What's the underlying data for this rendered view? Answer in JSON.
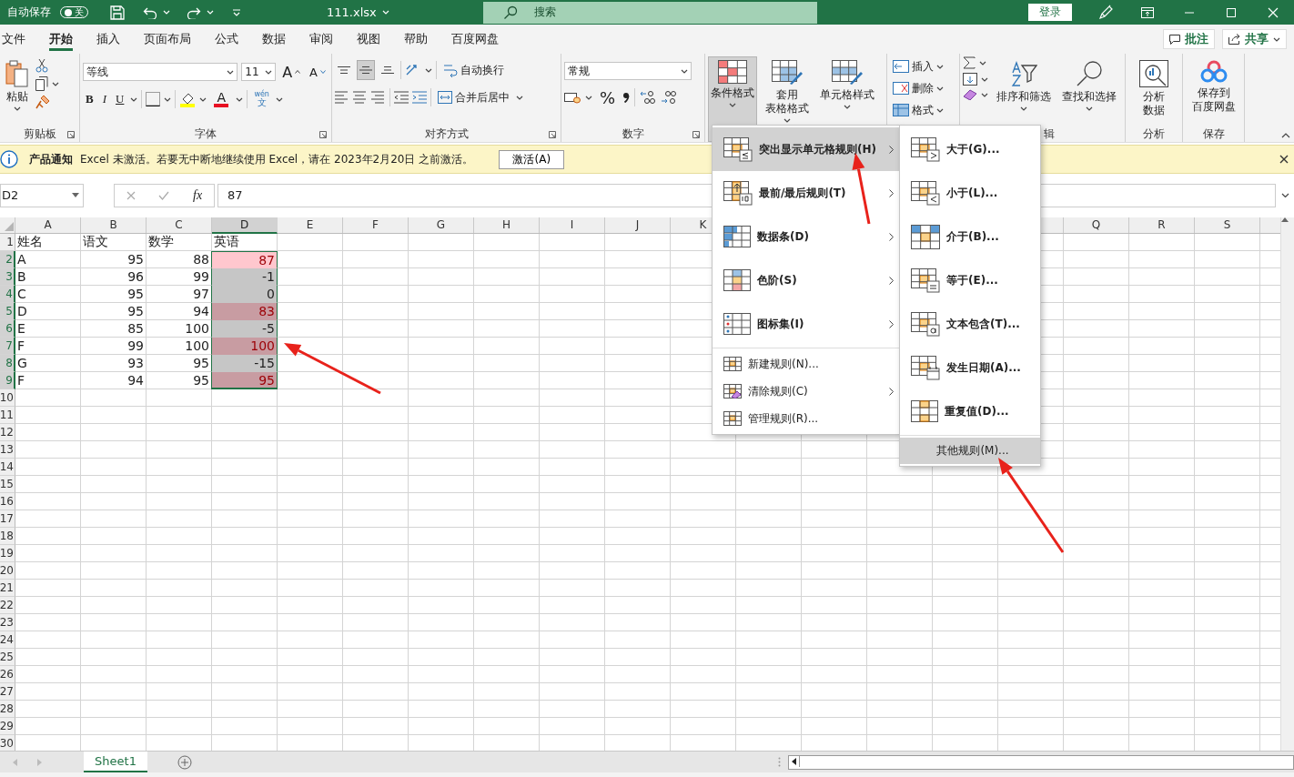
{
  "title_bar": {
    "autosave_label": "自动保存",
    "autosave": {
      "on": false,
      "label": "关"
    },
    "file_name": "111.xlsx",
    "search_placeholder": "搜索",
    "sign_in": "登录"
  },
  "tabs": [
    {
      "label": "文件",
      "selected": false
    },
    {
      "label": "开始",
      "selected": true
    },
    {
      "label": "插入",
      "selected": false
    },
    {
      "label": "页面布局",
      "selected": false
    },
    {
      "label": "公式",
      "selected": false
    },
    {
      "label": "数据",
      "selected": false
    },
    {
      "label": "审阅",
      "selected": false
    },
    {
      "label": "视图",
      "selected": false
    },
    {
      "label": "帮助",
      "selected": false
    },
    {
      "label": "百度网盘",
      "selected": false
    }
  ],
  "ribbon_actions": {
    "comments": "批注",
    "share": "共享"
  },
  "ribbon": {
    "clipboard": {
      "paste": "粘贴",
      "label": "剪贴板"
    },
    "font": {
      "font_name": "等线",
      "font_size": "11",
      "grow": "A",
      "shrink": "A",
      "bold": "B",
      "italic": "I",
      "underline": "U",
      "font_color": "A",
      "phonetic": [
        "wén",
        "文"
      ],
      "label": "字体"
    },
    "alignment": {
      "vertical_align": [
        {
          "selected": false
        },
        {
          "selected": true
        },
        {
          "selected": false
        }
      ],
      "wrap_text": "自动换行",
      "merge_center": "合并后居中",
      "label": "对齐方式"
    },
    "number": {
      "format": "常规",
      "percent": "%",
      "label": "数字"
    },
    "styles": [
      {
        "lines": [
          "条件格式"
        ],
        "pressed": true
      },
      {
        "lines": [
          "套用",
          "表格格式"
        ],
        "pressed": false
      },
      {
        "lines": [
          "单元格样式"
        ],
        "pressed": false
      }
    ],
    "cells": [
      {
        "label": "插入"
      },
      {
        "label": "删除"
      },
      {
        "label": "格式"
      }
    ],
    "editing": {
      "sort_filter": "排序和筛选",
      "find_select": "查找和选择",
      "label": "辑"
    },
    "analysis": {
      "button": [
        "分析",
        "数据"
      ],
      "label": "分析"
    },
    "save": {
      "button": [
        "保存到",
        "百度网盘"
      ],
      "label": "保存"
    }
  },
  "notification": {
    "title": "产品通知",
    "message": "Excel 未激活。若要无中断地继续使用 Excel，请在 2023年2月20日 之前激活。",
    "button": "激活(A)"
  },
  "formula_bar": {
    "name_box": "D2",
    "fx": "fx",
    "value": "87"
  },
  "columns": [
    {
      "label": "A",
      "selected": false
    },
    {
      "label": "B",
      "selected": false
    },
    {
      "label": "C",
      "selected": false
    },
    {
      "label": "D",
      "selected": true
    },
    {
      "label": "E",
      "selected": false
    },
    {
      "label": "F",
      "selected": false
    },
    {
      "label": "G",
      "selected": false
    },
    {
      "label": "H",
      "selected": false
    },
    {
      "label": "I",
      "selected": false
    },
    {
      "label": "J",
      "selected": false
    },
    {
      "label": "K",
      "selected": false
    },
    {
      "label": "Q",
      "selected": false
    },
    {
      "label": "R",
      "selected": false
    },
    {
      "label": "S",
      "selected": false
    }
  ],
  "rows": [
    {
      "number": "1",
      "selected": false,
      "cells": [
        {
          "value": "姓名",
          "kind": "text"
        },
        {
          "value": "语文",
          "kind": "text"
        },
        {
          "value": "数学",
          "kind": "text"
        },
        {
          "value": "英语",
          "kind": "text"
        }
      ]
    },
    {
      "number": "2",
      "selected": true,
      "cells": [
        {
          "value": "A",
          "kind": "text"
        },
        {
          "value": "95",
          "kind": "number"
        },
        {
          "value": "88",
          "kind": "number"
        },
        {
          "value": "87",
          "kind": "number",
          "highlight": true,
          "in_selection": true,
          "active": true
        }
      ]
    },
    {
      "number": "3",
      "selected": true,
      "cells": [
        {
          "value": "B",
          "kind": "text"
        },
        {
          "value": "96",
          "kind": "number"
        },
        {
          "value": "99",
          "kind": "number"
        },
        {
          "value": "-1",
          "kind": "number",
          "highlight": false,
          "in_selection": true,
          "active": false
        }
      ]
    },
    {
      "number": "4",
      "selected": true,
      "cells": [
        {
          "value": "C",
          "kind": "text"
        },
        {
          "value": "95",
          "kind": "number"
        },
        {
          "value": "97",
          "kind": "number"
        },
        {
          "value": "0",
          "kind": "number",
          "highlight": false,
          "in_selection": true,
          "active": false
        }
      ]
    },
    {
      "number": "5",
      "selected": true,
      "cells": [
        {
          "value": "D",
          "kind": "text"
        },
        {
          "value": "95",
          "kind": "number"
        },
        {
          "value": "94",
          "kind": "number"
        },
        {
          "value": "83",
          "kind": "number",
          "highlight": true,
          "in_selection": true,
          "active": false
        }
      ]
    },
    {
      "number": "6",
      "selected": true,
      "cells": [
        {
          "value": "E",
          "kind": "text"
        },
        {
          "value": "85",
          "kind": "number"
        },
        {
          "value": "100",
          "kind": "number"
        },
        {
          "value": "-5",
          "kind": "number",
          "highlight": false,
          "in_selection": true,
          "active": false
        }
      ]
    },
    {
      "number": "7",
      "selected": true,
      "cells": [
        {
          "value": "F",
          "kind": "text"
        },
        {
          "value": "99",
          "kind": "number"
        },
        {
          "value": "100",
          "kind": "number"
        },
        {
          "value": "100",
          "kind": "number",
          "highlight": true,
          "in_selection": true,
          "active": false
        }
      ]
    },
    {
      "number": "8",
      "selected": true,
      "cells": [
        {
          "value": "G",
          "kind": "text"
        },
        {
          "value": "93",
          "kind": "number"
        },
        {
          "value": "95",
          "kind": "number"
        },
        {
          "value": "-15",
          "kind": "number",
          "highlight": false,
          "in_selection": true,
          "active": false
        }
      ]
    },
    {
      "number": "9",
      "selected": true,
      "cells": [
        {
          "value": "F",
          "kind": "text"
        },
        {
          "value": "94",
          "kind": "number"
        },
        {
          "value": "95",
          "kind": "number"
        },
        {
          "value": "95",
          "kind": "number",
          "highlight": true,
          "in_selection": true,
          "active": false
        }
      ]
    },
    {
      "number": "10",
      "selected": false
    },
    {
      "number": "11",
      "selected": false
    },
    {
      "number": "12",
      "selected": false
    },
    {
      "number": "13",
      "selected": false
    },
    {
      "number": "14",
      "selected": false
    },
    {
      "number": "15",
      "selected": false
    },
    {
      "number": "16",
      "selected": false
    },
    {
      "number": "17",
      "selected": false
    },
    {
      "number": "18",
      "selected": false
    },
    {
      "number": "19",
      "selected": false
    },
    {
      "number": "20",
      "selected": false
    },
    {
      "number": "21",
      "selected": false
    },
    {
      "number": "22",
      "selected": false
    },
    {
      "number": "23",
      "selected": false
    },
    {
      "number": "24",
      "selected": false
    },
    {
      "number": "25",
      "selected": false
    },
    {
      "number": "26",
      "selected": false
    },
    {
      "number": "27",
      "selected": false
    },
    {
      "number": "28",
      "selected": false
    },
    {
      "number": "29",
      "selected": false
    },
    {
      "number": "30",
      "selected": false
    }
  ],
  "sheet_tabs": [
    {
      "label": "Sheet1",
      "selected": true
    }
  ],
  "conditional_menu": [
    {
      "label": "突出显示单元格规则(H)",
      "kind": "large",
      "has_submenu": true,
      "selected": true
    },
    {
      "label": "最前/最后规则(T)",
      "kind": "large",
      "has_submenu": true,
      "selected": false
    },
    {
      "label": "数据条(D)",
      "kind": "large",
      "has_submenu": true,
      "selected": false
    },
    {
      "label": "色阶(S)",
      "kind": "large",
      "has_submenu": true,
      "selected": false
    },
    {
      "label": "图标集(I)",
      "kind": "large",
      "has_submenu": true,
      "selected": false
    },
    {
      "label": "新建规则(N)...",
      "kind": "small",
      "has_submenu": false,
      "selected": false
    },
    {
      "label": "清除规则(C)",
      "kind": "small",
      "has_submenu": true,
      "selected": false
    },
    {
      "label": "管理规则(R)...",
      "kind": "small",
      "has_submenu": false,
      "selected": false
    }
  ],
  "highlight_submenu": [
    {
      "label": "大于(G)...",
      "kind": "large",
      "selected": false
    },
    {
      "label": "小于(L)...",
      "kind": "large",
      "selected": false
    },
    {
      "label": "介于(B)...",
      "kind": "large",
      "selected": false
    },
    {
      "label": "等于(E)...",
      "kind": "large",
      "selected": false
    },
    {
      "label": "文本包含(T)...",
      "kind": "large",
      "selected": false
    },
    {
      "label": "发生日期(A)...",
      "kind": "large",
      "selected": false
    },
    {
      "label": "重复值(D)...",
      "kind": "large",
      "selected": false
    },
    {
      "label": "其他规则(M)...",
      "kind": "small",
      "selected": true
    }
  ]
}
